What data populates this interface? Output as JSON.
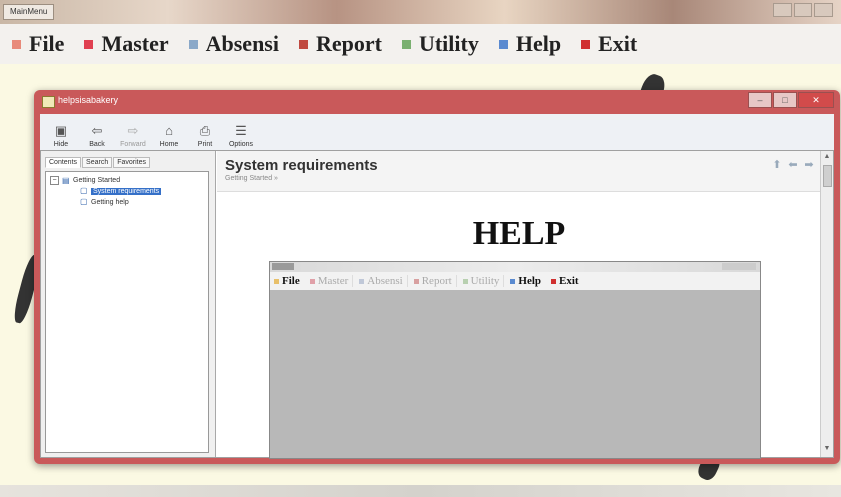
{
  "app": {
    "title": "MainMenu"
  },
  "menu": {
    "items": [
      {
        "label": "File",
        "color": "#e88a7a"
      },
      {
        "label": "Master",
        "color": "#e04050"
      },
      {
        "label": "Absensi",
        "color": "#8aa8c8"
      },
      {
        "label": "Report",
        "color": "#c04a40"
      },
      {
        "label": "Utility",
        "color": "#7ab070"
      },
      {
        "label": "Help",
        "color": "#5a8ad0"
      },
      {
        "label": "Exit",
        "color": "#d03030"
      }
    ]
  },
  "help_window": {
    "title": "helpsisabakery",
    "toolbar": [
      {
        "label": "Hide",
        "icon": "hide-icon",
        "glyph": "▣",
        "enabled": true
      },
      {
        "label": "Back",
        "icon": "back-arrow-icon",
        "glyph": "⇦",
        "enabled": true
      },
      {
        "label": "Forward",
        "icon": "forward-arrow-icon",
        "glyph": "⇨",
        "enabled": false
      },
      {
        "label": "Home",
        "icon": "home-icon",
        "glyph": "⌂",
        "enabled": true
      },
      {
        "label": "Print",
        "icon": "printer-icon",
        "glyph": "⎙",
        "enabled": true
      },
      {
        "label": "Options",
        "icon": "options-icon",
        "glyph": "☰",
        "enabled": true
      }
    ],
    "tabs": [
      "Contents",
      "Search",
      "Favorites"
    ],
    "tree": {
      "root": "Getting Started",
      "children": [
        "System requirements",
        "Getting help"
      ],
      "selected": "System requirements"
    },
    "topic": {
      "title": "System requirements",
      "breadcrumb": "Getting Started »",
      "heading": "HELP"
    },
    "embedded_menu": [
      {
        "label": "File",
        "bold": true,
        "color": "#e8c06a"
      },
      {
        "label": "Master",
        "bold": false,
        "color": "#e0a0a8"
      },
      {
        "label": "Absensi",
        "bold": false,
        "color": "#c0c8d8"
      },
      {
        "label": "Report",
        "bold": false,
        "color": "#d8a0a0"
      },
      {
        "label": "Utility",
        "bold": false,
        "color": "#b8d0b0"
      },
      {
        "label": "Help",
        "bold": true,
        "color": "#5a8ad0"
      },
      {
        "label": "Exit",
        "bold": true,
        "color": "#d03030"
      }
    ]
  }
}
